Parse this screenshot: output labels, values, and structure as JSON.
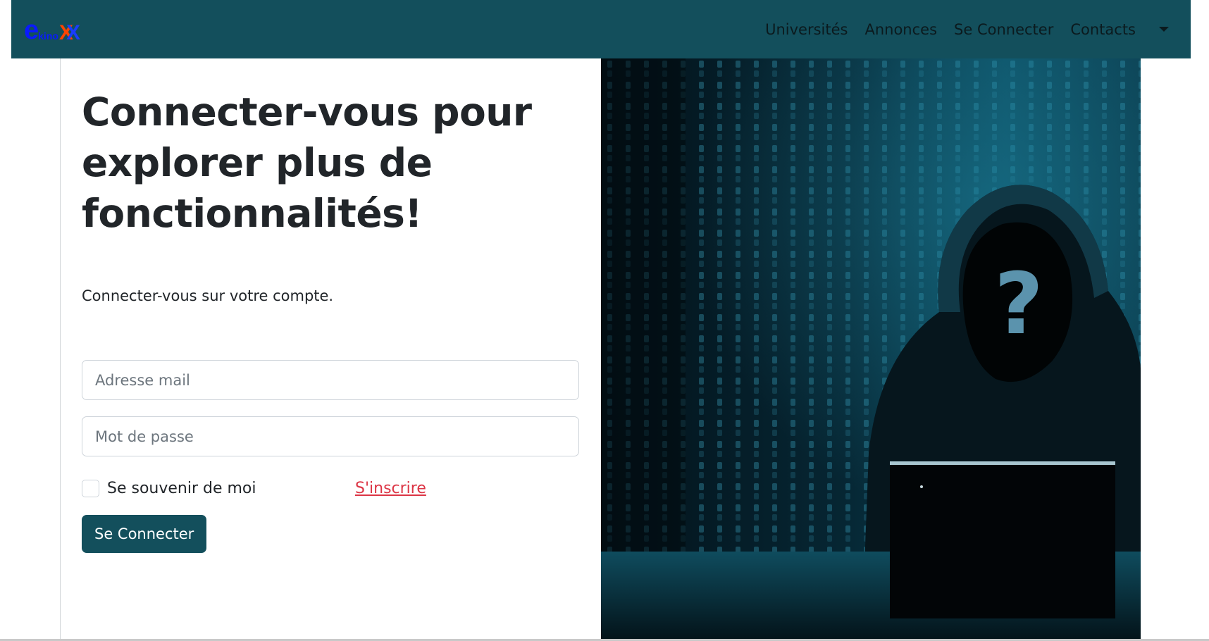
{
  "brand": {
    "part_e": "e",
    "part_kino": "kino",
    "part_x1": "X",
    "part_x2": "X"
  },
  "nav": {
    "items": [
      {
        "label": "Universités"
      },
      {
        "label": "Annonces"
      },
      {
        "label": "Se Connecter"
      },
      {
        "label": "Contacts"
      }
    ],
    "toggle_icon": "caret-down-icon"
  },
  "login": {
    "headline": "Connecter-vous pour explorer plus de fonctionnalités!",
    "subtitle": "Connecter-vous sur votre compte.",
    "email_placeholder": "Adresse mail",
    "email_value": "",
    "password_placeholder": "Mot de passe",
    "password_value": "",
    "remember_label": "Se souvenir de moi",
    "remember_checked": false,
    "signup_label": "S'inscrire",
    "submit_label": "Se Connecter"
  },
  "hero": {
    "icon": "hooded-hacker-illustration",
    "question_mark": "?"
  },
  "colors": {
    "navbar": "#134f5c",
    "button": "#134f5c",
    "link": "#dc3545",
    "brand_blue": "#0a1aff",
    "brand_orange": "#ff4400"
  }
}
